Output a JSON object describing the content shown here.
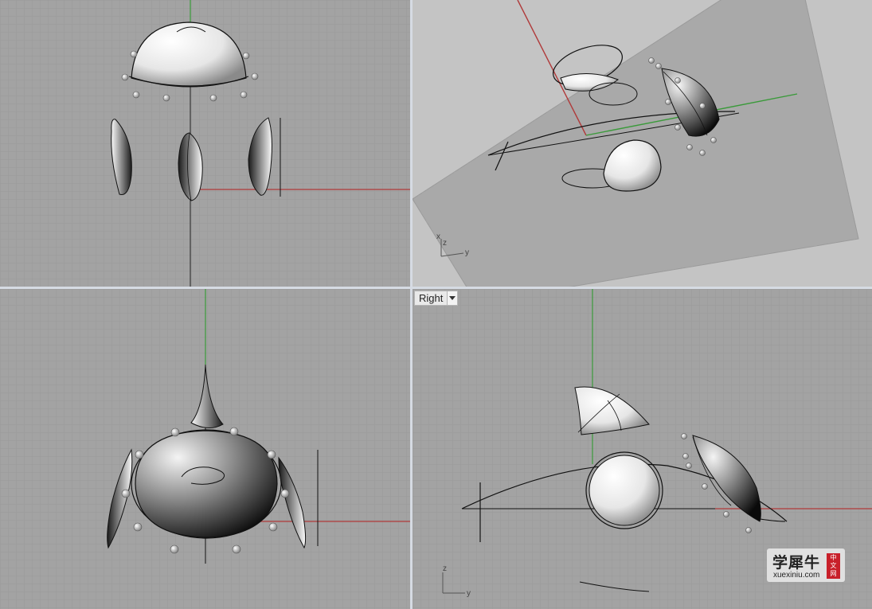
{
  "viewports": {
    "right": {
      "label": "Right",
      "dropdown_icon": "triangle-down-icon"
    }
  },
  "axis_labels": {
    "perspective": {
      "x": "x",
      "y": "y",
      "z": "z"
    },
    "right": {
      "y": "y",
      "z": "z"
    }
  },
  "colors": {
    "grid_bg": "#a3a3a3",
    "grid_minor": "#999999",
    "grid_major": "#8d8d8d",
    "x_axis": "#b03a3a",
    "y_axis": "#3a9a3a",
    "splitter": "#d6dbe3",
    "watermark_seal": "#c8202a"
  },
  "watermark": {
    "title": "学犀牛",
    "site": "xuexiniu.com",
    "seal": [
      "中",
      "文",
      "网"
    ]
  }
}
